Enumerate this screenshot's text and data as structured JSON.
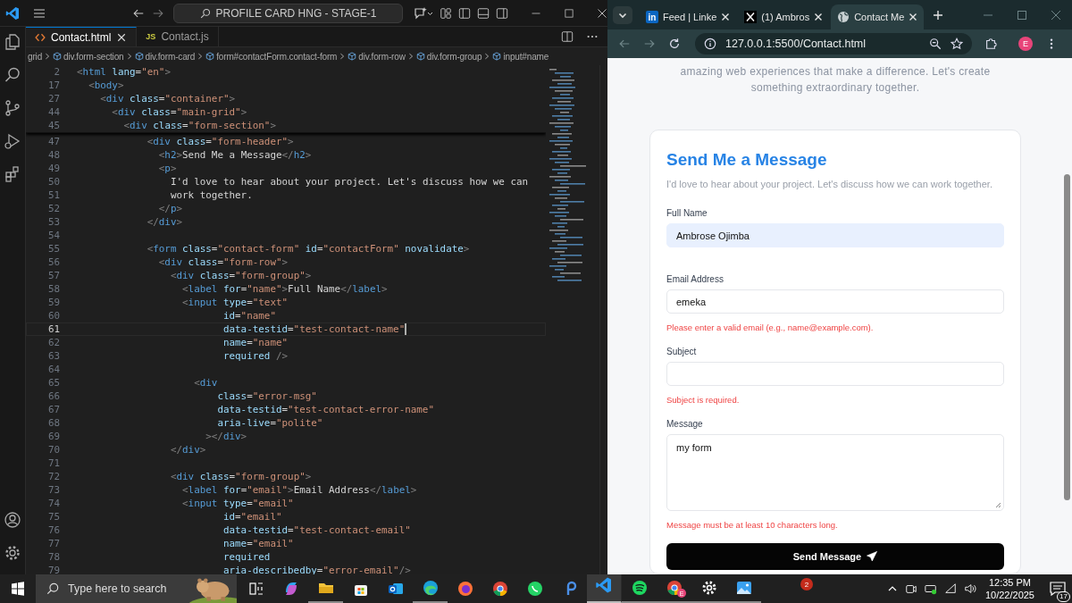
{
  "vscode": {
    "command_center": "PROFILE CARD HNG - STAGE-1",
    "tabs": [
      {
        "label": "Contact.html",
        "kind": "html",
        "selected": true
      },
      {
        "label": "Contact.js",
        "kind": "js",
        "icon_text": "JS",
        "selected": false
      }
    ],
    "breadcrumb": [
      {
        "label": "grid",
        "kind": "partial"
      },
      {
        "label": "div.form-section",
        "kind": "element"
      },
      {
        "label": "div.form-card",
        "kind": "element"
      },
      {
        "label": "form#contactForm.contact-form",
        "kind": "element"
      },
      {
        "label": "div.form-row",
        "kind": "element"
      },
      {
        "label": "div.form-group",
        "kind": "element"
      },
      {
        "label": "input#name",
        "kind": "element"
      }
    ],
    "sticky_lines": [
      {
        "number": "2",
        "text": "<html lang=\"en\">"
      },
      {
        "number": "17",
        "text": "  <body>"
      },
      {
        "number": "27",
        "text": "    <div class=\"container\">"
      },
      {
        "number": "44",
        "text": "      <div class=\"main-grid\">"
      },
      {
        "number": "45",
        "text": "        <div class=\"form-section\">"
      }
    ],
    "lines": [
      {
        "number": "47",
        "text": "            <div class=\"form-header\">",
        "current": false
      },
      {
        "number": "48",
        "text": "              <h2>Send Me a Message</h2>",
        "current": false
      },
      {
        "number": "49",
        "text": "              <p>",
        "current": false
      },
      {
        "number": "50",
        "text": "                I'd love to hear about your project. Let's discuss how we can",
        "current": false
      },
      {
        "number": "51",
        "text": "                work together.",
        "current": false
      },
      {
        "number": "52",
        "text": "              </p>",
        "current": false
      },
      {
        "number": "53",
        "text": "            </div>",
        "current": false
      },
      {
        "number": "54",
        "current": false
      },
      {
        "number": "55",
        "text": "            <form class=\"contact-form\" id=\"contactForm\" novalidate>",
        "current": false
      },
      {
        "number": "56",
        "text": "              <div class=\"form-row\">",
        "current": false
      },
      {
        "number": "57",
        "text": "                <div class=\"form-group\">",
        "current": false
      },
      {
        "number": "58",
        "text": "                  <label for=\"name\">Full Name</label>",
        "current": false
      },
      {
        "number": "59",
        "text": "                  <input type=\"text\"",
        "current": false
      },
      {
        "number": "60",
        "text": "                         id=\"name\"",
        "current": false
      },
      {
        "number": "61",
        "text": "                         data-testid=\"test-contact-name\"",
        "current": true
      },
      {
        "number": "62",
        "text": "                         name=\"name\"",
        "current": false
      },
      {
        "number": "63",
        "text": "                         required />",
        "current": false
      },
      {
        "number": "64",
        "current": false
      },
      {
        "number": "65",
        "text": "                    <div",
        "current": false
      },
      {
        "number": "66",
        "text": "                        class=\"error-msg\"",
        "current": false
      },
      {
        "number": "67",
        "text": "                        data-testid=\"test-contact-error-name\"",
        "current": false
      },
      {
        "number": "68",
        "text": "                        aria-live=\"polite\"",
        "current": false
      },
      {
        "number": "69",
        "text": "                      ></div>",
        "current": false
      },
      {
        "number": "70",
        "text": "                </div>",
        "current": false
      },
      {
        "number": "71",
        "current": false
      },
      {
        "number": "72",
        "text": "                <div class=\"form-group\">",
        "current": false
      },
      {
        "number": "73",
        "text": "                  <label for=\"email\">Email Address</label>",
        "current": false
      },
      {
        "number": "74",
        "text": "                  <input type=\"email\"",
        "current": false
      },
      {
        "number": "75",
        "text": "                         id=\"email\"",
        "current": false
      },
      {
        "number": "76",
        "text": "                         data-testid=\"test-contact-email\"",
        "current": false
      },
      {
        "number": "77",
        "text": "                         name=\"email\"",
        "current": false
      },
      {
        "number": "78",
        "text": "                         required",
        "current": false
      },
      {
        "number": "79",
        "text": "                         aria-describedby=\"error-email\"/>",
        "current": false
      }
    ]
  },
  "browser": {
    "tabs": [
      {
        "title": "Feed | Linke",
        "kind": "linkedin",
        "icon_text": "in",
        "selected": false
      },
      {
        "title": "(1) Ambros",
        "kind": "x",
        "selected": false
      },
      {
        "title": "Contact Me",
        "kind": "globe",
        "selected": true
      }
    ],
    "url": "127.0.0.1:5500/Contact.html",
    "profile": "E",
    "page": {
      "intro": "amazing web experiences that make a difference. Let's create\nsomething extraordinary together.",
      "title": "Send Me a Message",
      "subtitle": "I'd love to hear about your project. Let's discuss how we can work together.",
      "fields": [
        {
          "label": "Full Name",
          "kind": "input",
          "value": "Ambrose Ojimba",
          "autofilled": true
        },
        {
          "label": "Email Address",
          "kind": "input",
          "value": "emeka",
          "autofilled": false,
          "error": "Please enter a valid email (e.g., name@example.com)."
        },
        {
          "label": "Subject",
          "kind": "input",
          "autofilled": false,
          "error": "Subject is required."
        },
        {
          "label": "Message",
          "kind": "textarea",
          "value": "my form",
          "autofilled": false,
          "error": "Message must be at least 10 characters long."
        }
      ],
      "button": "Send Message"
    }
  },
  "taskbar": {
    "search_placeholder": "Type here to search",
    "apps": [
      {
        "kind": "taskview",
        "running": false,
        "active": false
      },
      {
        "kind": "copilot",
        "running": false,
        "active": false
      },
      {
        "kind": "files",
        "running": true,
        "active": false
      },
      {
        "kind": "store",
        "running": false,
        "active": false
      },
      {
        "kind": "outlook",
        "running": false,
        "active": false
      },
      {
        "kind": "edge",
        "running": true,
        "active": false
      },
      {
        "kind": "firefox",
        "running": false,
        "active": false
      },
      {
        "kind": "chrome",
        "running": false,
        "active": false
      },
      {
        "kind": "whatsapp",
        "running": false,
        "active": false
      },
      {
        "kind": "pen",
        "running": false,
        "active": false
      },
      {
        "kind": "vscode",
        "running": true,
        "active": true
      },
      {
        "kind": "spotify",
        "running": true,
        "active": false
      },
      {
        "kind": "chrome_profile",
        "running": true,
        "active": false,
        "badge": "E"
      },
      {
        "kind": "settings",
        "running": true,
        "active": false
      },
      {
        "kind": "photos",
        "running": true,
        "active": false
      }
    ],
    "badge": "2",
    "time": "12:35 PM",
    "date": "10/22/2025",
    "notifications": "17"
  }
}
